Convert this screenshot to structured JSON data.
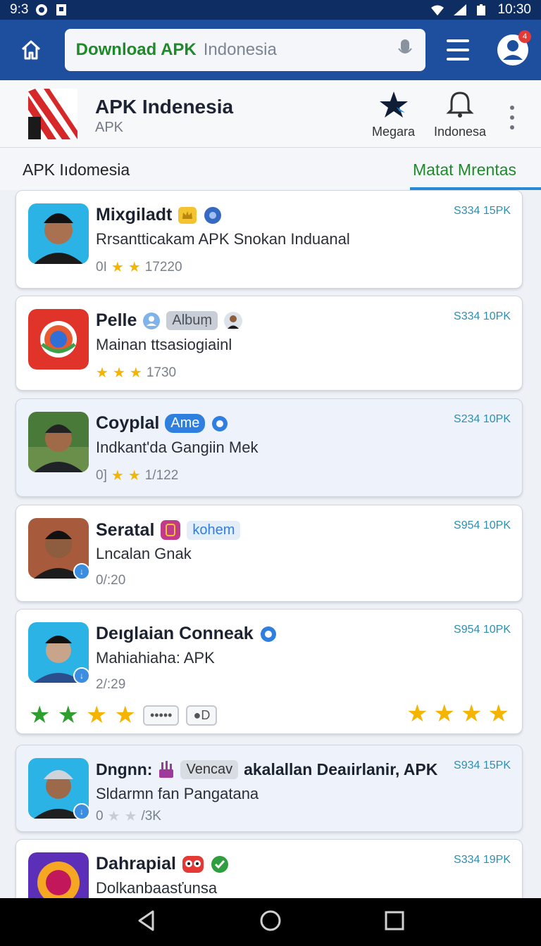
{
  "status": {
    "time_left": "9:3",
    "time_right": "10:30"
  },
  "search": {
    "query_main": "Download APK",
    "query_rest": "Indonesia"
  },
  "avatar_badge": "4",
  "header": {
    "title": "APK Indenesia",
    "subtitle": "APK",
    "action1": "Megara",
    "action2": "Indonesa"
  },
  "tabs": {
    "left": "APK Iıdomesia",
    "right": "Matat Mrentas"
  },
  "apps": [
    {
      "name": "Mixgiladt",
      "desc": "Rrsantticakam APK Snokan Induanal",
      "meta_prefix": "0I",
      "meta_count": "17220",
      "price": "S334 15PK"
    },
    {
      "name": "Pelle",
      "tag": "Albuṃ",
      "desc": "Mainan  ttsasiogiainl",
      "meta_count": "1730",
      "price": "S334 10PK"
    },
    {
      "name": "Coyplal",
      "tag": "Ame",
      "desc": "Indkant'da Gangiin Mek",
      "meta_prefix": "0]",
      "meta_count": "1/122",
      "price": "S234 10PK"
    },
    {
      "name": "Seratal",
      "tag": "kohem",
      "desc": "Lncalan Gnak",
      "meta_count": "0/:20",
      "price": "S954 10PK"
    },
    {
      "name": "Deıglaian Conneak",
      "desc": "Mahiahiaha: APK",
      "meta_count": "2/:29",
      "price": "S954 10PK",
      "pill1": "•••••",
      "pill2": "●D"
    },
    {
      "name": "Dngnn:",
      "tag": "Vencav",
      "name_rest": "akalallan Deaıirlanir, APK",
      "desc": "Sldarmn fan Pangatana",
      "meta_prefix": "0",
      "meta_count": "/3K",
      "price": "S934 15PK"
    },
    {
      "name": "Dahrapial",
      "desc": "Dolkanbaasťunsa",
      "price": "S334 19PK"
    }
  ]
}
